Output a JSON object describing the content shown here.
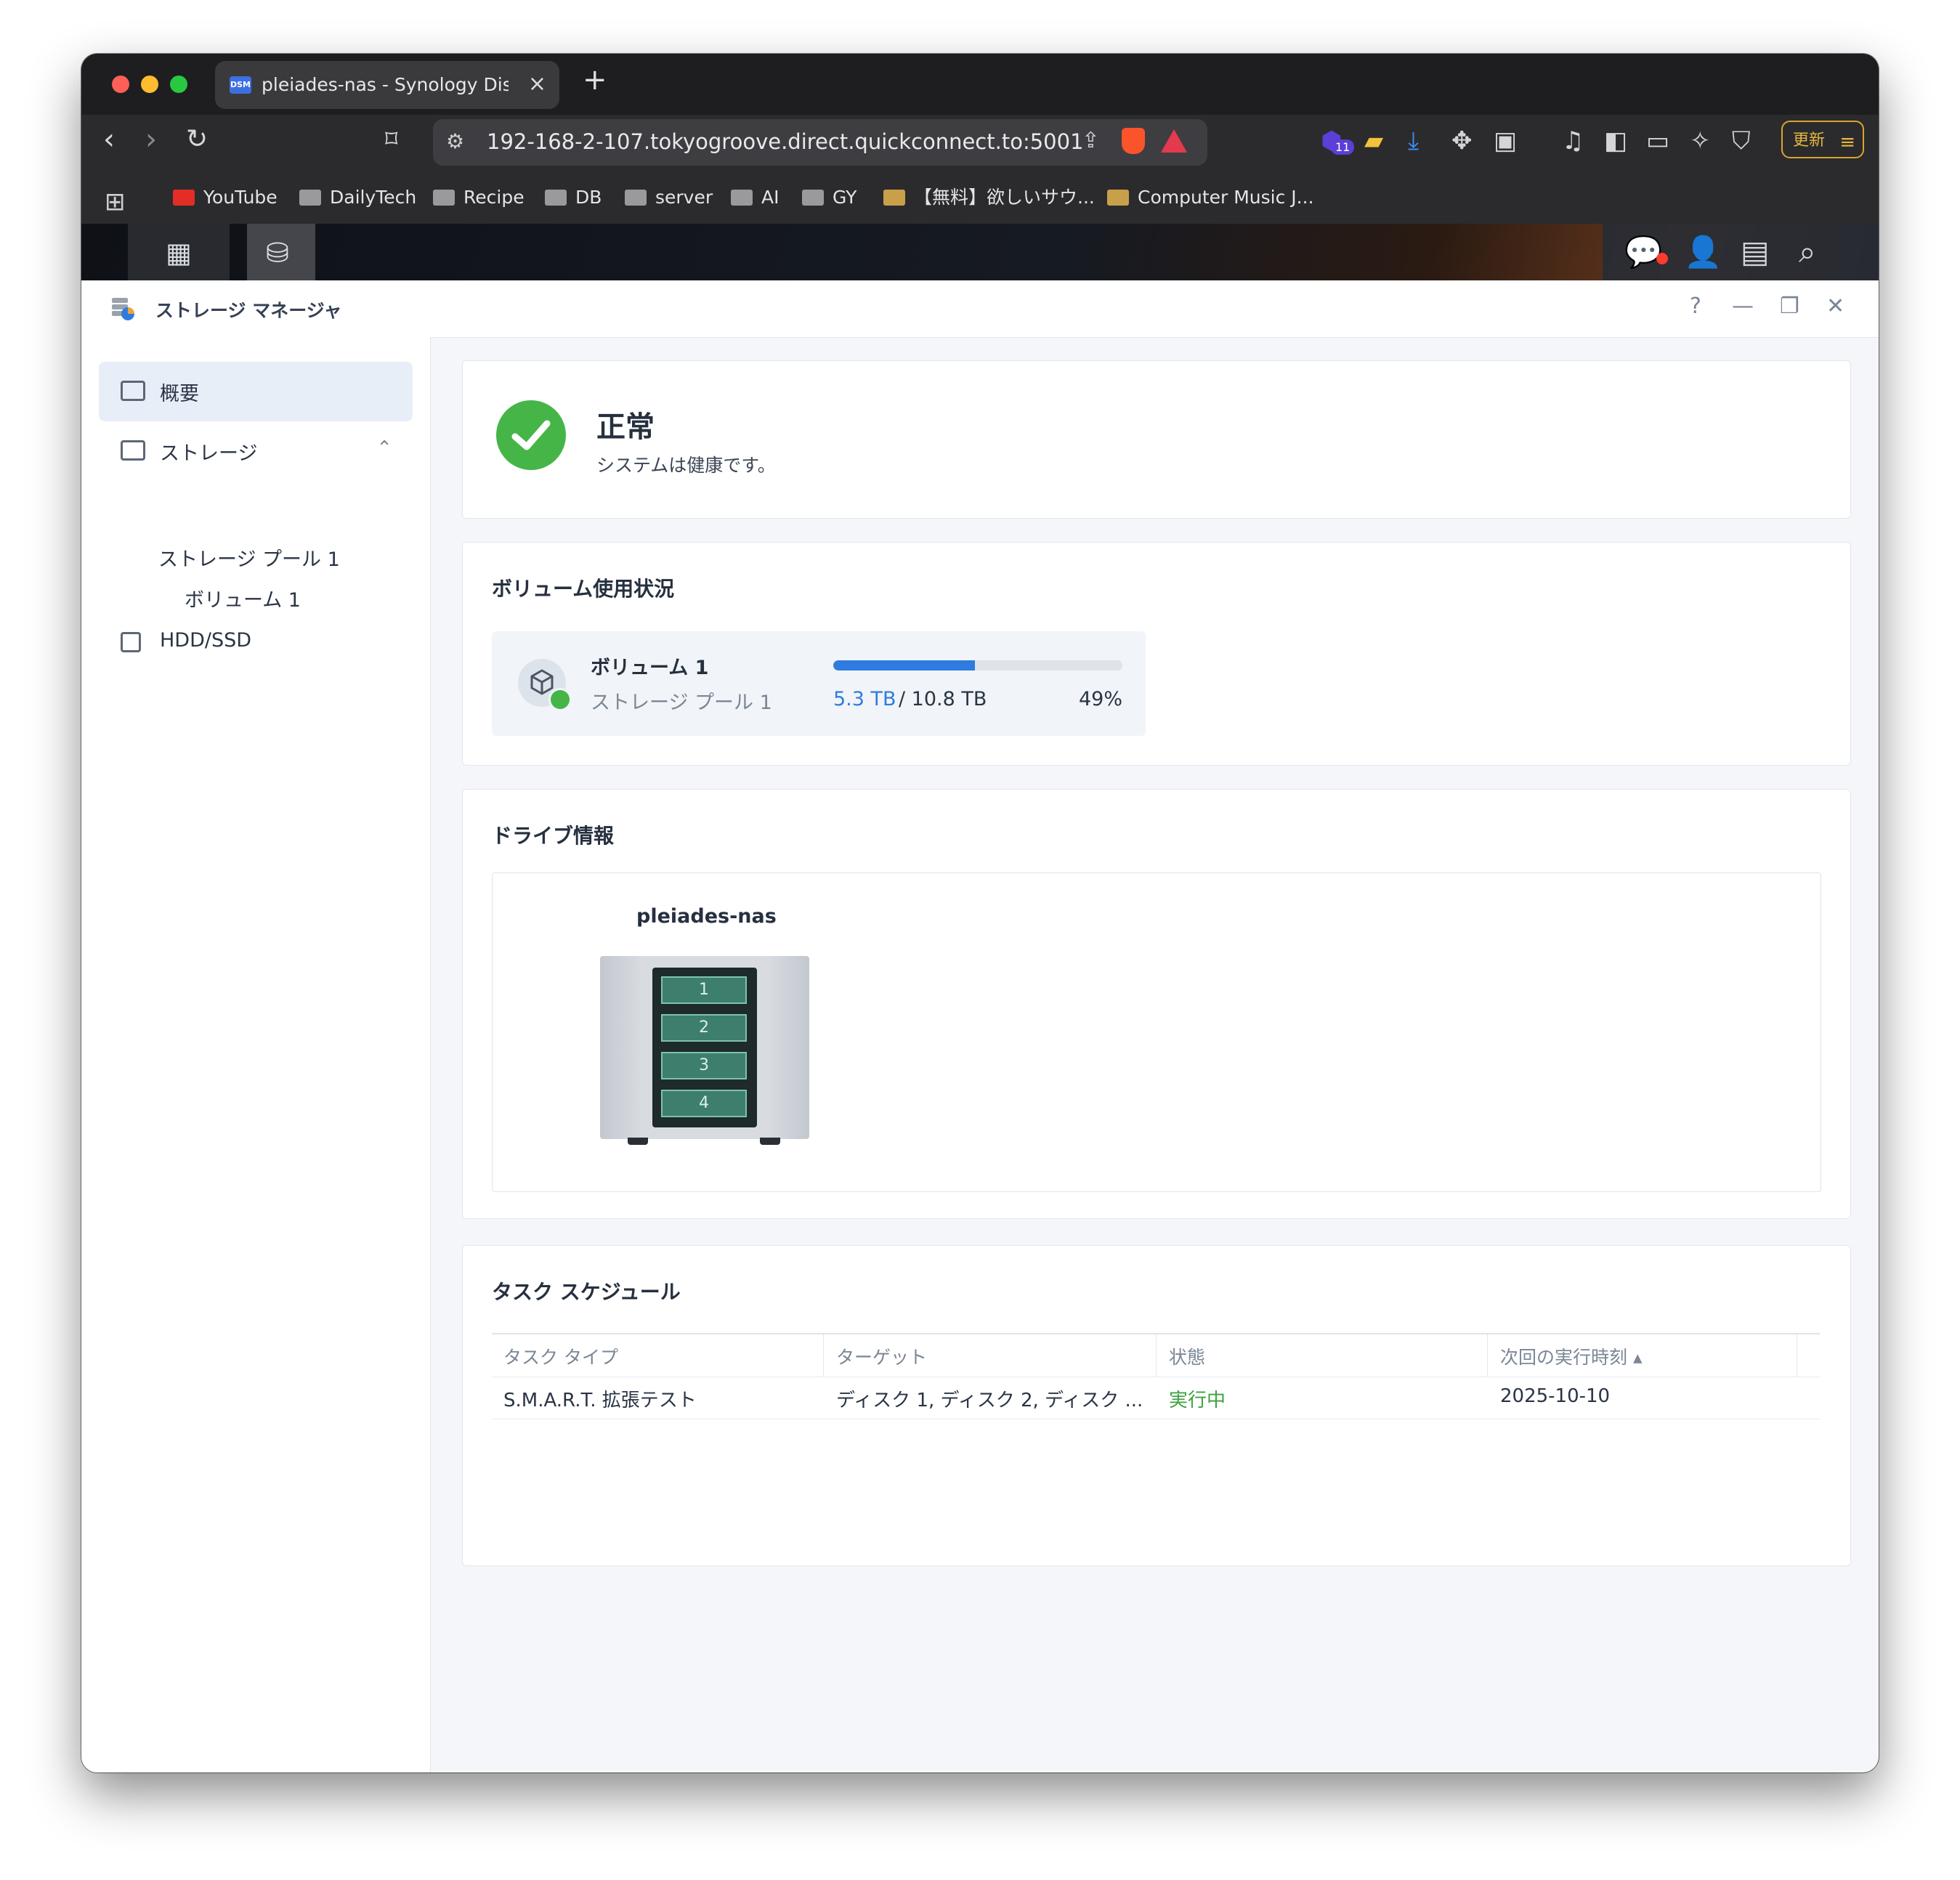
{
  "browser": {
    "tab_title": "pleiades-nas - Synology DiskS",
    "favicon_text": "DSM",
    "url": "192-168-2-107.tokyogroove.direct.quickconnect.to:5001",
    "extension_badge": "11",
    "update_label": "更新",
    "bookmarks": [
      "YouTube",
      "DailyTech",
      "Recipe",
      "DB",
      "server",
      "AI",
      "GY",
      "【無料】欲しいサウ...",
      "Computer Music J..."
    ]
  },
  "app": {
    "title": "ストレージ マネージャ",
    "help_label": "?"
  },
  "sidebar": {
    "overview": "概要",
    "storage": "ストレージ",
    "storage_pool": "ストレージ プール 1",
    "volume": "ボリューム 1",
    "hdd": "HDD/SSD"
  },
  "status": {
    "title": "正常",
    "description": "システムは健康です。"
  },
  "volume_usage": {
    "section_title": "ボリューム使用状況",
    "name": "ボリューム 1",
    "pool": "ストレージ プール 1",
    "used": "5.3 TB",
    "total": "/ 10.8 TB",
    "percent_label": "49%",
    "percent": 49
  },
  "drive_info": {
    "section_title": "ドライブ情報",
    "nas_name": "pleiades-nas",
    "bays": [
      "1",
      "2",
      "3",
      "4"
    ]
  },
  "task_schedule": {
    "section_title": "タスク スケジュール",
    "columns": [
      "タスク タイプ",
      "ターゲット",
      "状態",
      "次回の実行時刻 ▴"
    ],
    "rows": [
      [
        "S.M.A.R.T. 拡張テスト",
        "ディスク 1, ディスク 2, ディスク ...",
        "実行中",
        "2025-10-10"
      ]
    ]
  },
  "colors": {
    "accent": "#2f7be0",
    "ok_green": "#46b547",
    "running_green": "#3ca23e"
  }
}
